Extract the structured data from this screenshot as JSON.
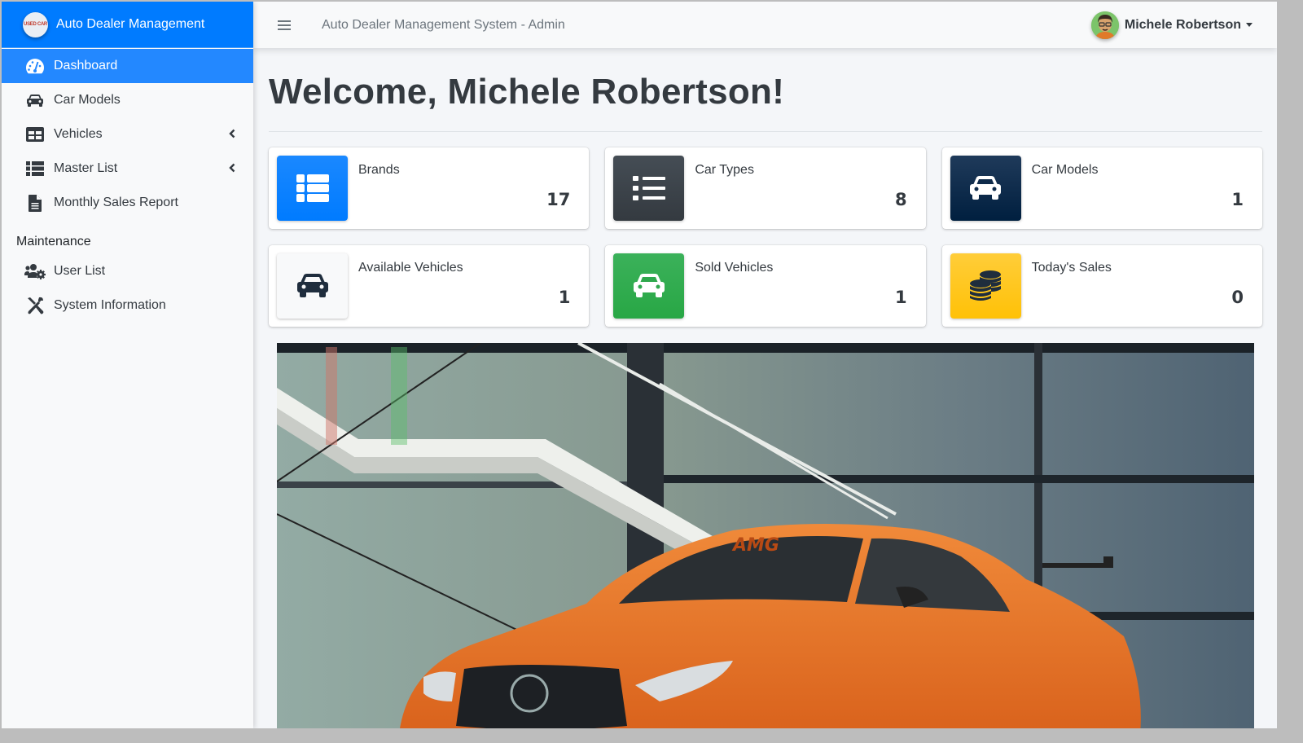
{
  "brand": {
    "logo_text": "USED CAR",
    "name": "Auto Dealer Management"
  },
  "sidebar": {
    "items": [
      {
        "label": "Dashboard",
        "icon": "tachometer-icon",
        "active": true
      },
      {
        "label": "Car Models",
        "icon": "car-icon"
      },
      {
        "label": "Vehicles",
        "icon": "table-icon",
        "has_submenu": true
      },
      {
        "label": "Master List",
        "icon": "th-list-icon",
        "has_submenu": true
      },
      {
        "label": "Monthly Sales Report",
        "icon": "file-alt-icon"
      }
    ],
    "section_header": "Maintenance",
    "maintenance_items": [
      {
        "label": "User List",
        "icon": "users-cog-icon"
      },
      {
        "label": "System Information",
        "icon": "tools-icon"
      }
    ]
  },
  "navbar": {
    "title": "Auto Dealer Management System - Admin",
    "user_name": "Michele Robertson"
  },
  "main": {
    "welcome": "Welcome, Michele Robertson!",
    "info_boxes": [
      {
        "label": "Brands",
        "value": "17",
        "icon": "th-list-icon",
        "color": "#007bff"
      },
      {
        "label": "Car Types",
        "value": "8",
        "icon": "list-icon",
        "color": "#343a40"
      },
      {
        "label": "Car Models",
        "value": "1",
        "icon": "car-icon",
        "color": "#001f3f"
      },
      {
        "label": "Available Vehicles",
        "value": "1",
        "icon": "car-icon",
        "color": "#f8f9fa"
      },
      {
        "label": "Sold Vehicles",
        "value": "1",
        "icon": "car-icon",
        "color": "#28a745"
      },
      {
        "label": "Today's Sales",
        "value": "0",
        "icon": "coins-icon",
        "color": "#ffc107"
      }
    ],
    "banner_alt": "Orange sports car"
  }
}
